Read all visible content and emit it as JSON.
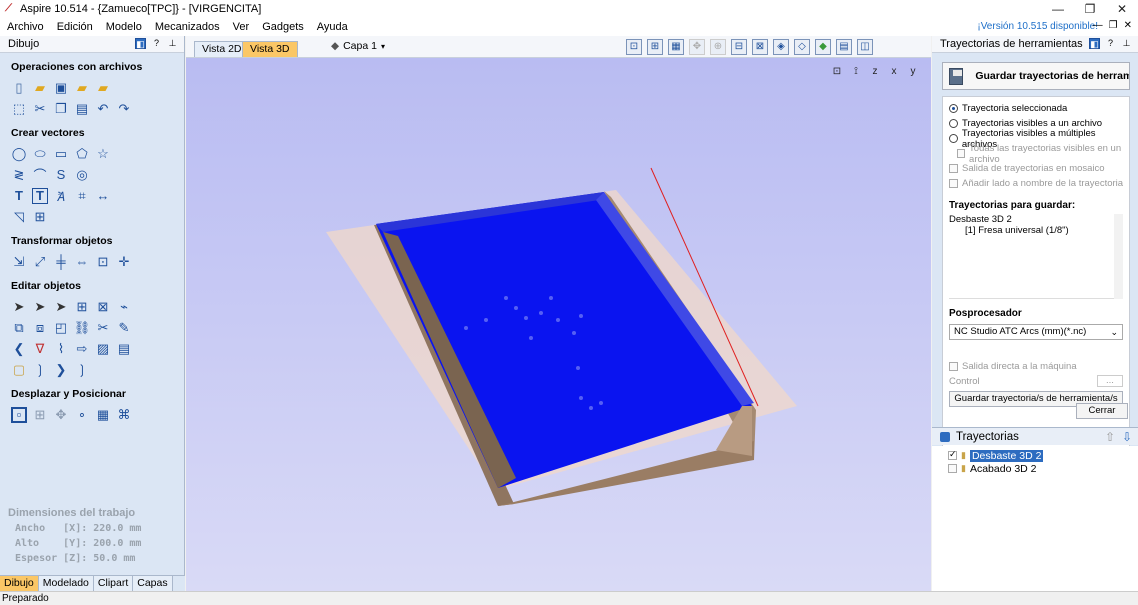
{
  "window": {
    "title": "Aspire 10.514 - {Zamueco[TPC]} - [VIRGENCITA]"
  },
  "menu": {
    "items": [
      "Archivo",
      "Edición",
      "Modelo",
      "Mecanizados",
      "Ver",
      "Gadgets",
      "Ayuda"
    ],
    "version_notice": "¡Versión 10.515 disponible!"
  },
  "left_panel": {
    "title": "Dibujo",
    "sections": [
      "Operaciones con archivos",
      "Crear vectores",
      "Transformar objetos",
      "Editar objetos",
      "Desplazar y Posicionar"
    ],
    "job": {
      "header": "Dimensiones del trabajo",
      "width": "Ancho   [X]: 220.0 mm",
      "height": "Alto    [Y]: 200.0 mm",
      "thickness": "Espesor [Z]: 50.0 mm"
    },
    "tabs": [
      "Dibujo",
      "Modelado",
      "Clipart",
      "Capas"
    ]
  },
  "center": {
    "tabs": [
      "Vista 2D",
      "Vista 3D"
    ],
    "layer_label": "Capa 1",
    "viewport_icons": [
      "zoom-fit-icon",
      "axis-icon",
      "z-view-icon",
      "x-view-icon",
      "y-view-icon"
    ]
  },
  "right_panel": {
    "title": "Trayectorias de herramientas",
    "save_button": "Guardar trayectorias de herramientas",
    "radio_selected": "Trayectoria seleccionada",
    "radio_visible_one": "Trayectorias visibles a un archivo",
    "radio_visible_multi": "Trayectorias visibles a múltiples archivos",
    "chk_all_visible": "Todas las trayectorias visibles en un archivo",
    "chk_tiled": "Salida de trayectorias en mosaico",
    "chk_append_name": "Añadir lado a nombre de la trayectoria",
    "to_save_header": "Trayectorias para guardar:",
    "to_save_list": [
      "Desbaste 3D 2",
      "[1] Fresa universal (1/8\")"
    ],
    "post_header": "Posprocesador",
    "post_value": "NC Studio ATC Arcs (mm)(*.nc)",
    "direct_output": "Salida directa a la máquina",
    "control_label": "Control",
    "control_button": "...",
    "save_toolpaths_button": "Guardar trayectoria/s de herramienta/s",
    "close_button": "Cerrar",
    "list_header": "Trayectorias",
    "toolpaths": [
      "Desbaste 3D 2",
      "Acabado 3D 2"
    ]
  },
  "status": {
    "text": "Preparado"
  },
  "colors": {
    "accent": "#2d6cc0",
    "tab_active": "#fbc766",
    "panel_bg": "#dbe6f4",
    "viewport_bg": "#c7c9f4",
    "model_blue": "#0a14f0",
    "stock_brown": "#9a7d64"
  }
}
